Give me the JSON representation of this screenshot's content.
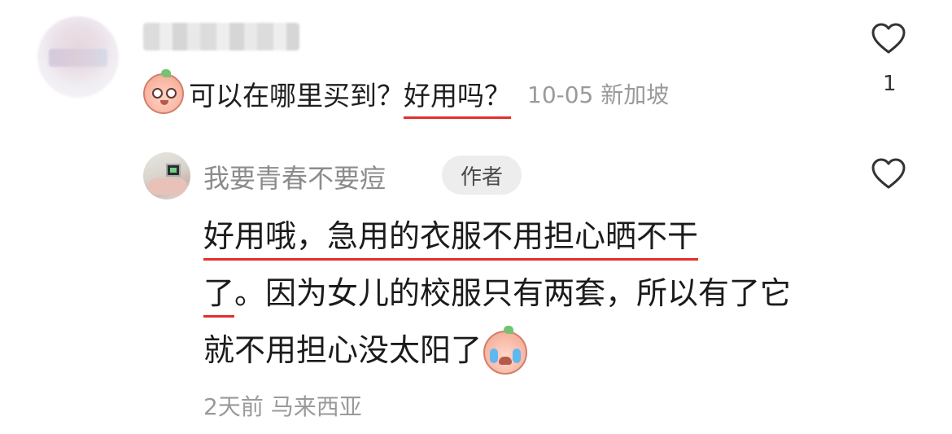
{
  "comment": {
    "avatar_icon": "blurred-avatar",
    "username_icon": "blurred-username",
    "emoji_icon": "peach-shocked-emoji",
    "text_plain": "可以在哪里买到？",
    "text_underlined": "好用吗？",
    "date": "10-05",
    "location": "新加坡",
    "like_icon": "heart-outline-icon",
    "like_count": "1"
  },
  "reply": {
    "avatar_icon": "user-avatar",
    "username": "我要青春不要痘",
    "author_badge": "作者",
    "text_underlined_1": "好用哦，急用的衣服不用担心晒不干",
    "text_underlined_2": "了",
    "text_rest": "。因为女儿的校服只有两套，所以有了它就不用担心没太阳了",
    "emoji_icon": "peach-crying-emoji",
    "time": "2天前",
    "location": "马来西亚",
    "like_icon": "heart-outline-icon"
  },
  "colors": {
    "underline": "#e0302a",
    "meta_gray": "#9a9a9a"
  }
}
